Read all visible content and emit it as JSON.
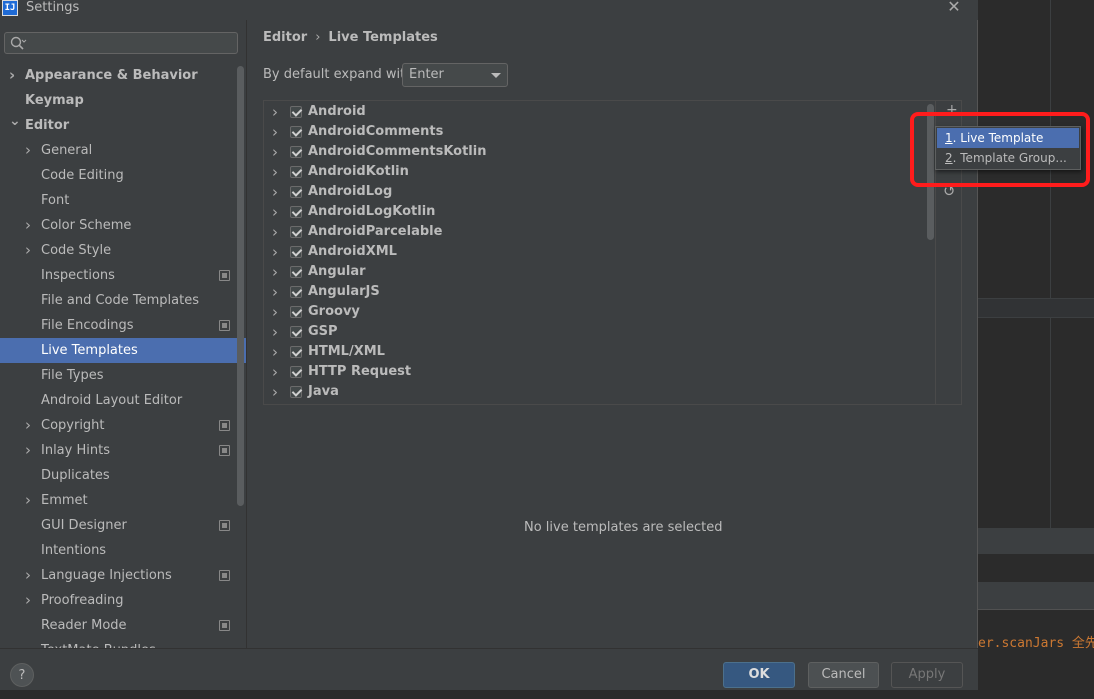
{
  "window": {
    "title": "Settings",
    "app_icon_text": "IJ"
  },
  "search": {
    "placeholder": "",
    "value": ""
  },
  "sidebar": {
    "items": [
      {
        "label": "Appearance & Behavior",
        "level": 0,
        "expandable": true,
        "expanded": false,
        "bold": true,
        "project": false
      },
      {
        "label": "Keymap",
        "level": 0,
        "expandable": false,
        "bold": true,
        "project": false
      },
      {
        "label": "Editor",
        "level": 0,
        "expandable": true,
        "expanded": true,
        "bold": true,
        "project": false
      },
      {
        "label": "General",
        "level": 1,
        "expandable": true,
        "expanded": false,
        "project": false
      },
      {
        "label": "Code Editing",
        "level": 1,
        "expandable": false,
        "project": false
      },
      {
        "label": "Font",
        "level": 1,
        "expandable": false,
        "project": false
      },
      {
        "label": "Color Scheme",
        "level": 1,
        "expandable": true,
        "expanded": false,
        "project": false
      },
      {
        "label": "Code Style",
        "level": 1,
        "expandable": true,
        "expanded": false,
        "project": false
      },
      {
        "label": "Inspections",
        "level": 1,
        "expandable": false,
        "project": true
      },
      {
        "label": "File and Code Templates",
        "level": 1,
        "expandable": false,
        "project": false
      },
      {
        "label": "File Encodings",
        "level": 1,
        "expandable": false,
        "project": true
      },
      {
        "label": "Live Templates",
        "level": 1,
        "expandable": false,
        "project": false,
        "selected": true
      },
      {
        "label": "File Types",
        "level": 1,
        "expandable": false,
        "project": false
      },
      {
        "label": "Android Layout Editor",
        "level": 1,
        "expandable": false,
        "project": false
      },
      {
        "label": "Copyright",
        "level": 1,
        "expandable": true,
        "expanded": false,
        "project": true
      },
      {
        "label": "Inlay Hints",
        "level": 1,
        "expandable": true,
        "expanded": false,
        "project": true
      },
      {
        "label": "Duplicates",
        "level": 1,
        "expandable": false,
        "project": false
      },
      {
        "label": "Emmet",
        "level": 1,
        "expandable": true,
        "expanded": false,
        "project": false
      },
      {
        "label": "GUI Designer",
        "level": 1,
        "expandable": false,
        "project": true
      },
      {
        "label": "Intentions",
        "level": 1,
        "expandable": false,
        "project": false
      },
      {
        "label": "Language Injections",
        "level": 1,
        "expandable": true,
        "expanded": false,
        "project": true
      },
      {
        "label": "Proofreading",
        "level": 1,
        "expandable": true,
        "expanded": false,
        "project": false
      },
      {
        "label": "Reader Mode",
        "level": 1,
        "expandable": false,
        "project": true
      },
      {
        "label": "TextMate Bundles",
        "level": 1,
        "expandable": false,
        "project": false
      }
    ]
  },
  "breadcrumb": {
    "parent": "Editor",
    "separator": "›",
    "current": "Live Templates"
  },
  "expand": {
    "label": "By default expand with",
    "value": "Enter"
  },
  "templates": [
    {
      "name": "Android",
      "checked": true
    },
    {
      "name": "AndroidComments",
      "checked": true
    },
    {
      "name": "AndroidCommentsKotlin",
      "checked": true
    },
    {
      "name": "AndroidKotlin",
      "checked": true
    },
    {
      "name": "AndroidLog",
      "checked": true
    },
    {
      "name": "AndroidLogKotlin",
      "checked": true
    },
    {
      "name": "AndroidParcelable",
      "checked": true
    },
    {
      "name": "AndroidXML",
      "checked": true
    },
    {
      "name": "Angular",
      "checked": true
    },
    {
      "name": "AngularJS",
      "checked": true
    },
    {
      "name": "Groovy",
      "checked": true
    },
    {
      "name": "GSP",
      "checked": true
    },
    {
      "name": "HTML/XML",
      "checked": true
    },
    {
      "name": "HTTP Request",
      "checked": true
    },
    {
      "name": "Java",
      "checked": true
    }
  ],
  "toolbar": {
    "add_glyph": "+",
    "undo_glyph": "↺"
  },
  "popup": {
    "items": [
      {
        "mnemonic": "1",
        "label": ". Live Template",
        "highlighted": true
      },
      {
        "mnemonic": "2",
        "label": ". Template Group...",
        "highlighted": false
      }
    ]
  },
  "empty_message": "No live templates are selected",
  "buttons": {
    "help": "?",
    "ok": "OK",
    "cancel": "Cancel",
    "apply": "Apply"
  },
  "background_code": "er.scanJars 全先",
  "colors": {
    "accent": "#4b6eaf",
    "highlight_box": "#ff1c1c",
    "ok_button": "#365880"
  }
}
